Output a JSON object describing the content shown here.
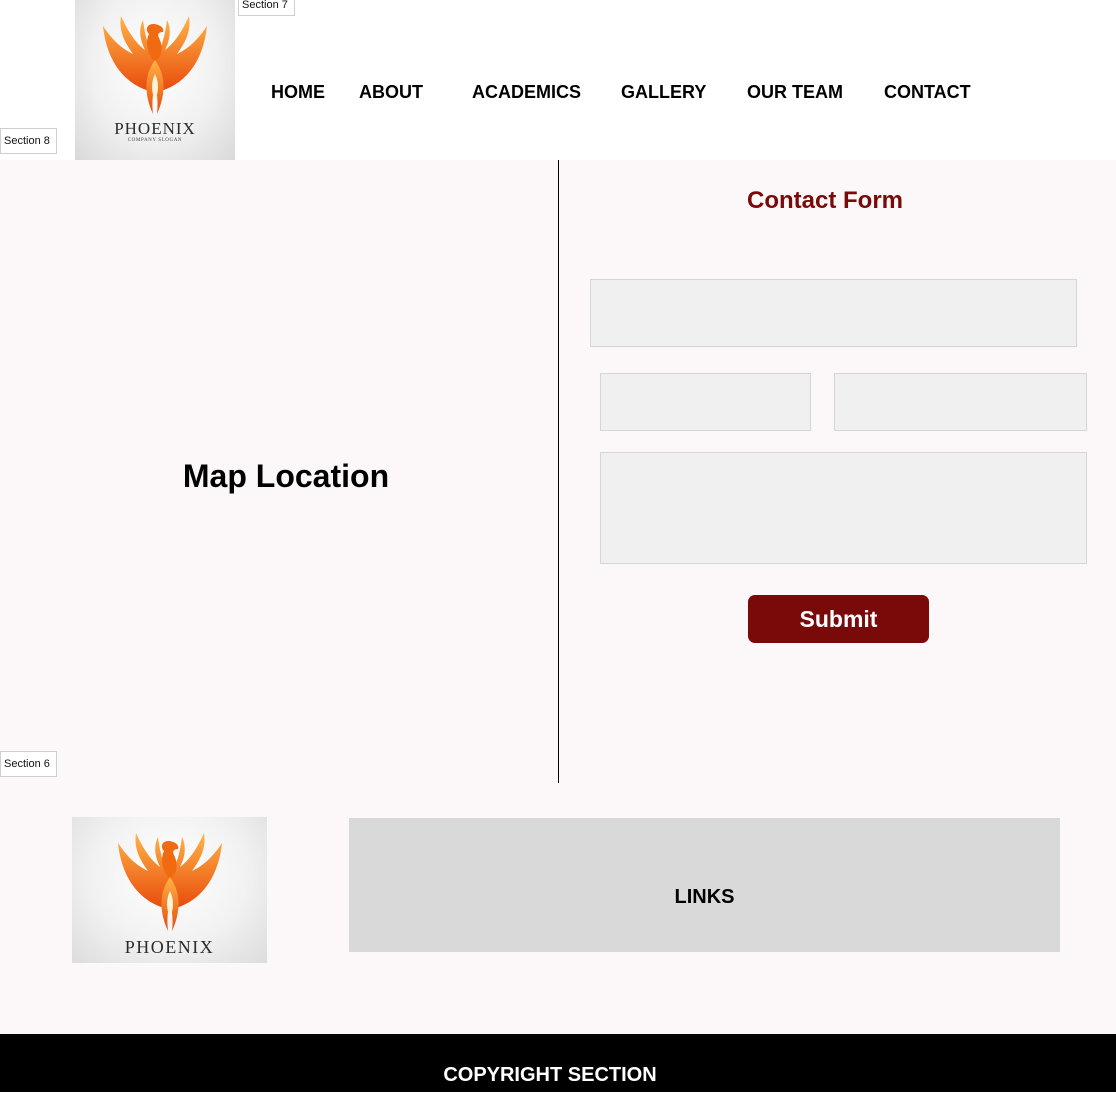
{
  "header": {
    "logo": {
      "name": "PHOENIX",
      "slogan": "COMPANY SLOGAN",
      "icon": "phoenix-bird-icon",
      "colors": {
        "flame_light": "#ffb347",
        "flame_dark": "#e84a0c"
      }
    },
    "section_tags": {
      "top": "Section 7",
      "left": "Section 8"
    },
    "nav": [
      {
        "label": "HOME"
      },
      {
        "label": "ABOUT"
      },
      {
        "label": "ACADEMICS"
      },
      {
        "label": "GALLERY"
      },
      {
        "label": "OUR TEAM"
      },
      {
        "label": "CONTACT"
      }
    ]
  },
  "contact": {
    "map_title": "Map Location",
    "form_title": "Contact Form",
    "submit_label": "Submit",
    "colors": {
      "accent": "#7a0a0a",
      "background": "#fcf8fa",
      "field": "#f0f0f0"
    }
  },
  "footer": {
    "section_tag": "Section 6",
    "logo": {
      "name": "PHOENIX",
      "icon": "phoenix-bird-icon"
    },
    "links_label": "LINKS",
    "copyright_label": "COPYRIGHT SECTION",
    "colors": {
      "links_bg": "#d9d9d9",
      "copyright_bg": "#000000"
    }
  }
}
